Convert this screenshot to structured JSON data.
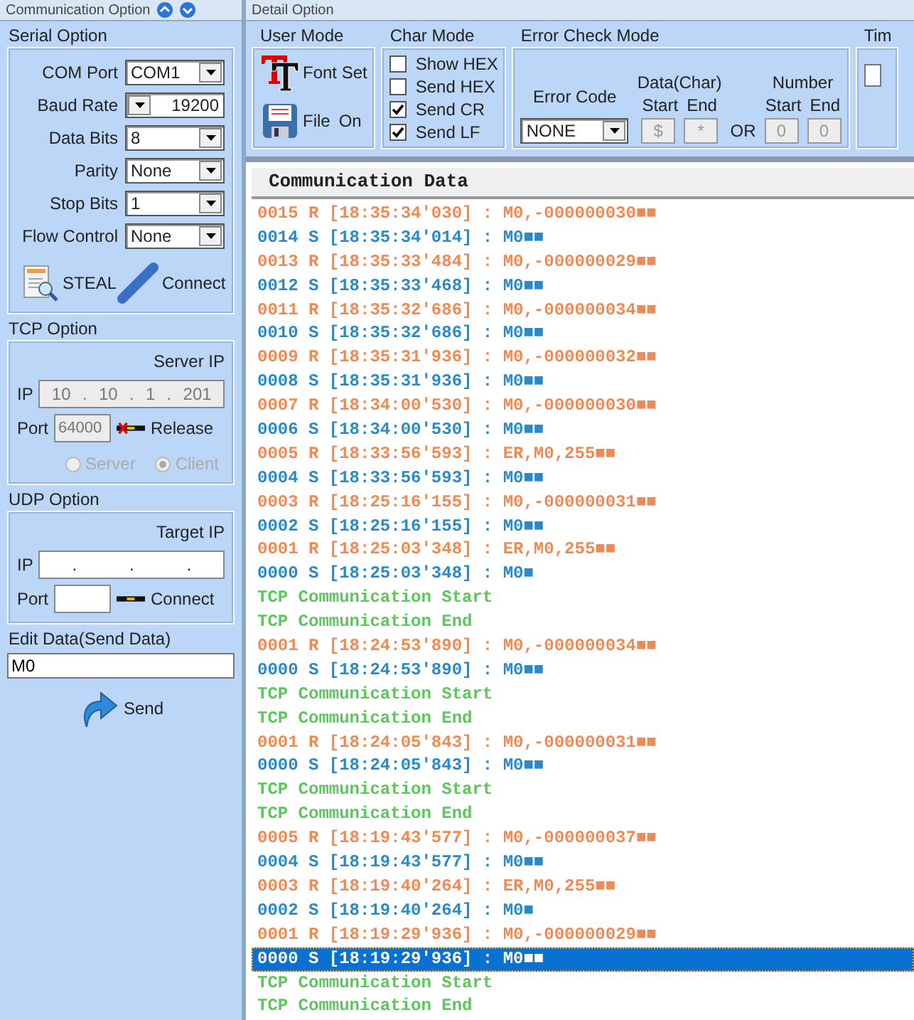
{
  "left_panel": {
    "title": "Communication Option",
    "serial": {
      "title": "Serial Option",
      "fields": [
        {
          "label": "COM Port",
          "value": "COM1",
          "kind": "combo"
        },
        {
          "label": "Baud Rate",
          "value": "19200",
          "kind": "spin"
        },
        {
          "label": "Data Bits",
          "value": "8",
          "kind": "combo"
        },
        {
          "label": "Parity",
          "value": "None",
          "kind": "combo"
        },
        {
          "label": "Stop Bits",
          "value": "1",
          "kind": "combo"
        },
        {
          "label": "Flow Control",
          "value": "None",
          "kind": "combo"
        }
      ],
      "buttons": [
        {
          "label": "STEAL"
        },
        {
          "label": "Connect"
        }
      ]
    },
    "tcp": {
      "title": "TCP Option",
      "ip_caption": "Server IP",
      "ip_label": "IP",
      "ip_octets": [
        "10",
        "10",
        "1",
        "201"
      ],
      "ip_separators": [
        ".",
        ".",
        "."
      ],
      "port_label": "Port",
      "port": "64000",
      "disabled": true,
      "link_label": "Release",
      "released": true,
      "modes": [
        {
          "label": "Server",
          "selected": false
        },
        {
          "label": "Client",
          "selected": true
        }
      ]
    },
    "udp": {
      "title": "UDP Option",
      "ip_caption": "Target IP",
      "ip_label": "IP",
      "ip_separators": [
        ".",
        ".",
        "."
      ],
      "port_label": "Port",
      "disabled": false,
      "link_label": "Connect",
      "released": false
    },
    "send": {
      "title": "Edit Data(Send Data)",
      "value": "M0",
      "button": "Send"
    }
  },
  "top_panel": {
    "title": "Detail Option",
    "user_mode": {
      "title": "User Mode",
      "items": [
        {
          "label": "Font Set"
        },
        {
          "label": "File",
          "state": "On"
        }
      ]
    },
    "char_mode": {
      "title": "Char Mode",
      "options": [
        {
          "label": "Show HEX",
          "checked": false
        },
        {
          "label": "Send HEX",
          "checked": false
        },
        {
          "label": "Send CR",
          "checked": true
        },
        {
          "label": "Send LF",
          "checked": true
        }
      ]
    },
    "error_check": {
      "title": "Error Check Mode",
      "code_label": "Error Code",
      "code_value": "NONE",
      "data": {
        "label": "Data(Char)",
        "start_label": "Start",
        "end_label": "End",
        "start": "$",
        "end": "*"
      },
      "or": "OR",
      "number": {
        "label": "Number",
        "start_label": "Start",
        "end_label": "End",
        "start": "0",
        "end": "0"
      }
    },
    "timer": {
      "title": "Tim"
    }
  },
  "log": {
    "title": "Communication Data",
    "lines": [
      {
        "kind": "received",
        "text": "0015 R [18:35:34'030] : M0,-000000030■■",
        "selected": false
      },
      {
        "kind": "sent",
        "text": "0014 S [18:35:34'014] : M0■■",
        "selected": false
      },
      {
        "kind": "received",
        "text": "0013 R [18:35:33'484] : M0,-000000029■■",
        "selected": false
      },
      {
        "kind": "sent",
        "text": "0012 S [18:35:33'468] : M0■■",
        "selected": false
      },
      {
        "kind": "received",
        "text": "0011 R [18:35:32'686] : M0,-000000034■■",
        "selected": false
      },
      {
        "kind": "sent",
        "text": "0010 S [18:35:32'686] : M0■■",
        "selected": false
      },
      {
        "kind": "received",
        "text": "0009 R [18:35:31'936] : M0,-000000032■■",
        "selected": false
      },
      {
        "kind": "sent",
        "text": "0008 S [18:35:31'936] : M0■■",
        "selected": false
      },
      {
        "kind": "received",
        "text": "0007 R [18:34:00'530] : M0,-000000030■■",
        "selected": false
      },
      {
        "kind": "sent",
        "text": "0006 S [18:34:00'530] : M0■■",
        "selected": false
      },
      {
        "kind": "received",
        "text": "0005 R [18:33:56'593] : ER,M0,255■■",
        "selected": false
      },
      {
        "kind": "sent",
        "text": "0004 S [18:33:56'593] : M0■■",
        "selected": false
      },
      {
        "kind": "received",
        "text": "0003 R [18:25:16'155] : M0,-000000031■■",
        "selected": false
      },
      {
        "kind": "sent",
        "text": "0002 S [18:25:16'155] : M0■■",
        "selected": false
      },
      {
        "kind": "received",
        "text": "0001 R [18:25:03'348] : ER,M0,255■■",
        "selected": false
      },
      {
        "kind": "sent",
        "text": "0000 S [18:25:03'348] : M0■",
        "selected": false
      },
      {
        "kind": "status",
        "text": "TCP Communication Start",
        "selected": false
      },
      {
        "kind": "status",
        "text": "TCP Communication End",
        "selected": false
      },
      {
        "kind": "received",
        "text": "0001 R [18:24:53'890] : M0,-000000034■■",
        "selected": false
      },
      {
        "kind": "sent",
        "text": "0000 S [18:24:53'890] : M0■■",
        "selected": false
      },
      {
        "kind": "status",
        "text": "TCP Communication Start",
        "selected": false
      },
      {
        "kind": "status",
        "text": "TCP Communication End",
        "selected": false
      },
      {
        "kind": "received",
        "text": "0001 R [18:24:05'843] : M0,-000000031■■",
        "selected": false
      },
      {
        "kind": "sent",
        "text": "0000 S [18:24:05'843] : M0■■",
        "selected": false
      },
      {
        "kind": "status",
        "text": "TCP Communication Start",
        "selected": false
      },
      {
        "kind": "status",
        "text": "TCP Communication End",
        "selected": false
      },
      {
        "kind": "received",
        "text": "0005 R [18:19:43'577] : M0,-000000037■■",
        "selected": false
      },
      {
        "kind": "sent",
        "text": "0004 S [18:19:43'577] : M0■■",
        "selected": false
      },
      {
        "kind": "received",
        "text": "0003 R [18:19:40'264] : ER,M0,255■■",
        "selected": false
      },
      {
        "kind": "sent",
        "text": "0002 S [18:19:40'264] : M0■",
        "selected": false
      },
      {
        "kind": "received",
        "text": "0001 R [18:19:29'936] : M0,-000000029■■",
        "selected": false
      },
      {
        "kind": "sent",
        "text": "0000 S [18:19:29'936] : M0■■",
        "selected": true
      },
      {
        "kind": "status",
        "text": "TCP Communication Start",
        "selected": false
      },
      {
        "kind": "status",
        "text": "TCP Communication End",
        "selected": false
      }
    ]
  }
}
